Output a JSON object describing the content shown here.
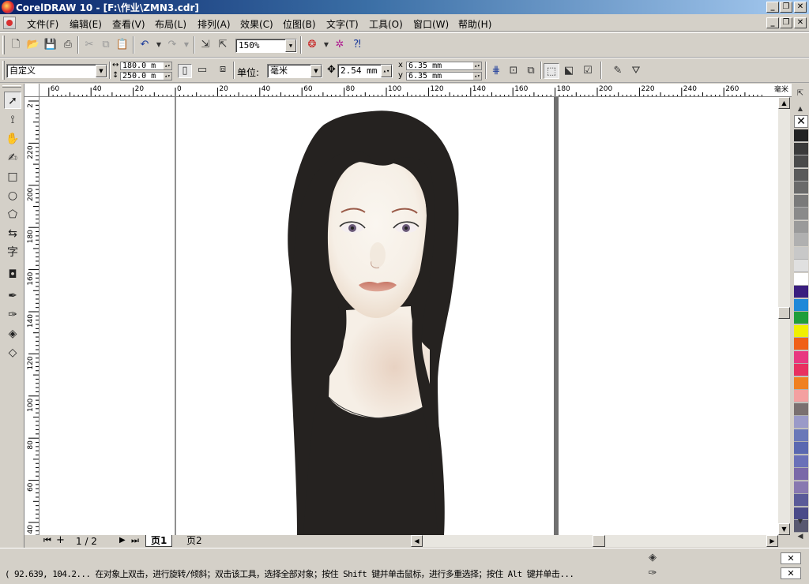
{
  "window": {
    "title": "CorelDRAW 10 - [F:\\作业\\ZMN3.cdr]",
    "min_label": "_",
    "max_label": "❐",
    "close_label": "✕"
  },
  "menu": [
    {
      "label": "文件(F)"
    },
    {
      "label": "编辑(E)"
    },
    {
      "label": "查看(V)"
    },
    {
      "label": "布局(L)"
    },
    {
      "label": "排列(A)"
    },
    {
      "label": "效果(C)"
    },
    {
      "label": "位图(B)"
    },
    {
      "label": "文字(T)"
    },
    {
      "label": "工具(O)"
    },
    {
      "label": "窗口(W)"
    },
    {
      "label": "帮助(H)"
    }
  ],
  "toolbar": {
    "zoom": "150%",
    "icons": [
      "new-icon",
      "open-icon",
      "save-icon",
      "print-icon",
      "cut-icon",
      "copy-icon",
      "paste-icon",
      "undo-icon",
      "redo-icon",
      "import-icon",
      "export-icon",
      "application-launcher-icon",
      "corel-online-icon",
      "whats-this-icon"
    ]
  },
  "property_bar": {
    "paper_preset": "自定义",
    "width": "180.0 m",
    "height": "250.0 m",
    "unit_label": "单位:",
    "unit": "毫米",
    "nudge": "2.54 mm",
    "dup_x": "6.35 mm",
    "dup_y": "6.35 mm",
    "dup_x_label": "x",
    "dup_y_label": "y"
  },
  "rulers": {
    "unit": "毫米",
    "h_ticks": [
      {
        "label": "60",
        "value": -60
      },
      {
        "label": "40",
        "value": -40
      },
      {
        "label": "20",
        "value": -20
      },
      {
        "label": "0",
        "value": 0
      },
      {
        "label": "20",
        "value": 20
      },
      {
        "label": "40",
        "value": 40
      },
      {
        "label": "60",
        "value": 60
      },
      {
        "label": "80",
        "value": 80
      },
      {
        "label": "100",
        "value": 100
      },
      {
        "label": "120",
        "value": 120
      },
      {
        "label": "140",
        "value": 140
      },
      {
        "label": "160",
        "value": 160
      },
      {
        "label": "180",
        "value": 180
      },
      {
        "label": "200",
        "value": 200
      },
      {
        "label": "220",
        "value": 220
      },
      {
        "label": "240",
        "value": 240
      },
      {
        "label": "260",
        "value": 260
      }
    ],
    "v_ticks": [
      {
        "label": "2",
        "value": 240
      },
      {
        "label": "220",
        "value": 220
      },
      {
        "label": "200",
        "value": 200
      },
      {
        "label": "180",
        "value": 180
      },
      {
        "label": "160",
        "value": 160
      },
      {
        "label": "140",
        "value": 140
      },
      {
        "label": "120",
        "value": 120
      },
      {
        "label": "100",
        "value": 100
      },
      {
        "label": "80",
        "value": 80
      },
      {
        "label": "60",
        "value": 60
      },
      {
        "label": "40",
        "value": 40
      }
    ]
  },
  "page_nav": {
    "counter": "1 / 2",
    "first": "⏮",
    "add": "+",
    "next": "▶",
    "last": "⏭",
    "tabs": [
      {
        "label": "页1",
        "active": true
      },
      {
        "label": "页2",
        "active": false
      }
    ]
  },
  "statusbar": {
    "text": "( 92.639, 104.2...  在对象上双击，进行旋转/倾斜；双击该工具，选择全部对象；按住 Shift 键并单击鼠标，进行多重选择；按住 Alt 键并单击..."
  },
  "palette": {
    "colors": [
      "#222222",
      "#3a3a3a",
      "#4a4a4a",
      "#5a5a5a",
      "#6a6a6a",
      "#7a7a7a",
      "#8a8a8a",
      "#9a9a9a",
      "#b0b0b0",
      "#c8c8c8",
      "#e0e0e0",
      "#ffffff",
      "#3a1e7e",
      "#1e88d8",
      "#1e9e3a",
      "#f0f000",
      "#f06018",
      "#e83880",
      "#e83060",
      "#f08020",
      "#f4a0a0",
      "#7a7070",
      "#9a9ac8",
      "#6a78b8",
      "#5a68b0",
      "#6a70b8",
      "#7a68a8",
      "#8878b0",
      "#5a5a98",
      "#4a4a88",
      "#585870"
    ]
  },
  "toolbox": {
    "icons": [
      "pick-tool-icon",
      "shape-tool-icon",
      "zoom-tool-icon",
      "freehand-tool-icon",
      "rectangle-tool-icon",
      "ellipse-tool-icon",
      "polygon-tool-icon",
      "spiral-tool-icon",
      "text-tool-icon",
      "interactive-tool-icon",
      "eyedropper-tool-icon",
      "outline-tool-icon",
      "fill-tool-icon",
      "interactive-fill-icon"
    ]
  }
}
